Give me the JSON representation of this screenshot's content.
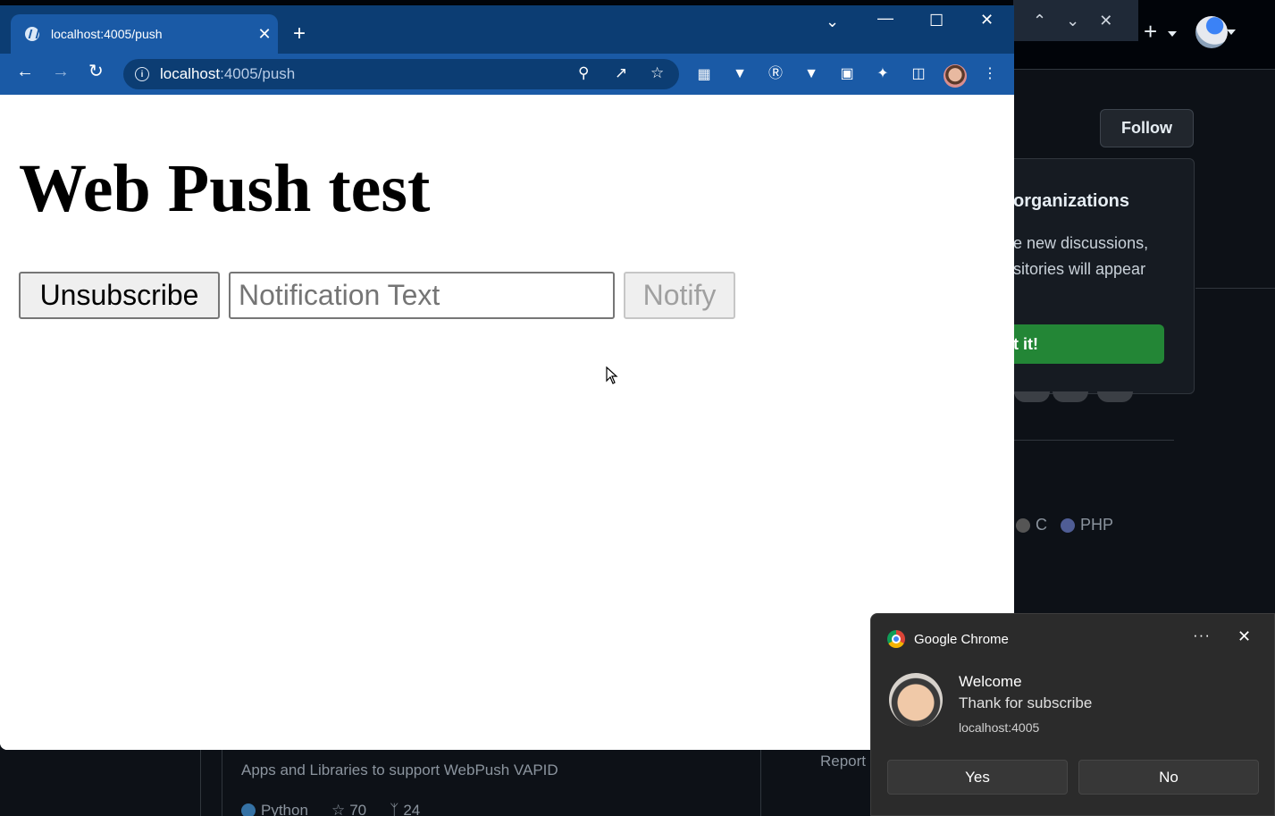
{
  "browser": {
    "tab_title": "localhost:4005/push",
    "url_host": "localhost",
    "url_path": ":4005/push"
  },
  "page": {
    "heading": "Web Push test",
    "unsubscribe_label": "Unsubscribe",
    "notification_placeholder": "Notification Text",
    "notification_value": "",
    "notify_label": "Notify"
  },
  "notification": {
    "app_name": "Google Chrome",
    "title": "Welcome",
    "body": "Thank for subscribe",
    "origin": "localhost:4005",
    "yes_label": "Yes",
    "no_label": "No"
  },
  "background": {
    "follow_label": "Follow",
    "card_title": "organizations",
    "card_text": "e new discussions,\nsitories will appear",
    "card_button": "t it!",
    "languages": [
      {
        "name": "C",
        "color": "#555555"
      },
      {
        "name": "PHP",
        "color": "#4F5D95"
      }
    ],
    "repo_description": "Apps and Libraries to support WebPush VAPID",
    "repo_language": "Python",
    "repo_language_color": "#3572A5",
    "repo_stars": "70",
    "repo_forks": "24",
    "report_text": "Report a"
  }
}
